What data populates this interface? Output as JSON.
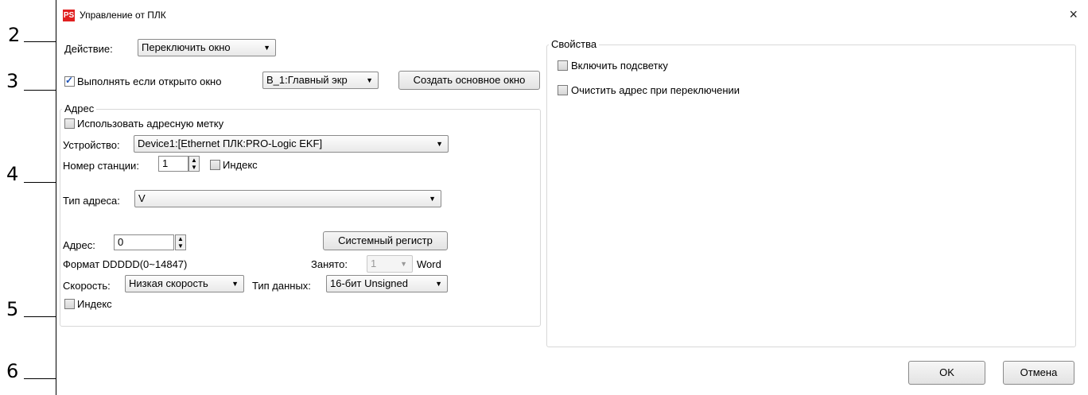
{
  "callouts": [
    "2",
    "3",
    "4",
    "5",
    "6"
  ],
  "window": {
    "icon": "PS",
    "title": "Управление от ПЛК",
    "close_icon": "×"
  },
  "action": {
    "label": "Действие:",
    "value": "Переключить окно"
  },
  "exec_if_open": {
    "checked": true,
    "label": "Выполнять если открыто окно",
    "window_value": "B_1:Главный экр",
    "create_button": "Создать основное окно"
  },
  "address_group": {
    "title": "Адрес",
    "use_tag": {
      "checked": false,
      "label": "Использовать адресную метку"
    },
    "device": {
      "label": "Устройство:",
      "value": "Device1:[Ethernet ПЛК:PRO-Logic EKF]"
    },
    "station": {
      "label": "Номер станции:",
      "value": "1",
      "index_label": "Индекс"
    },
    "addr_type": {
      "label": "Тип адреса:",
      "value": "V"
    },
    "address": {
      "label": "Адрес:",
      "value": "0",
      "sys_reg_button": "Системный регистр"
    },
    "format": "Формат DDDDD(0~14847)",
    "occupied": {
      "label": "Занято:",
      "value": "1",
      "unit": "Word"
    },
    "speed": {
      "label": "Скорость:",
      "value": "Низкая скорость"
    },
    "datatype": {
      "label": "Тип данных:",
      "value": "16-бит Unsigned"
    },
    "index": {
      "checked": false,
      "label": "Индекс"
    }
  },
  "properties_group": {
    "title": "Свойства",
    "backlight": {
      "checked": false,
      "label": "Включить подсветку"
    },
    "clear_address": {
      "checked": false,
      "label": "Очистить адрес при переключении"
    }
  },
  "buttons": {
    "ok": "OK",
    "cancel": "Отмена"
  }
}
